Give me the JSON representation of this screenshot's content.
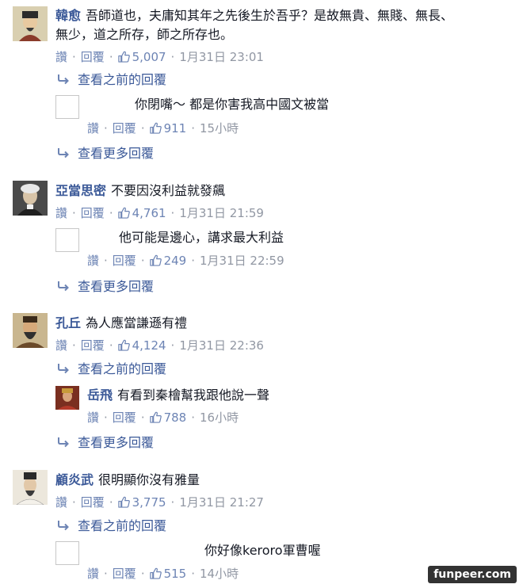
{
  "comments": [
    {
      "name": "韓愈",
      "text_line1": "吾師道也，夫庸知其年之先後生於吾乎？是故無貴、無賤、無長、",
      "text_line2": "無少，道之所存，師之所存也。",
      "like_label": "讚",
      "reply_label": "回覆",
      "likes": "5,007",
      "time": "1月31日 23:01",
      "prev_replies": "查看之前的回覆",
      "reply": {
        "name": "",
        "text": "你閉嘴～ 都是你害我高中國文被當",
        "like_label": "讚",
        "reply_label": "回覆",
        "likes": "911",
        "time": "15小時"
      },
      "more_replies": "查看更多回覆"
    },
    {
      "name": "亞當思密",
      "text_line1": "不要因沒利益就發飆",
      "like_label": "讚",
      "reply_label": "回覆",
      "likes": "4,761",
      "time": "1月31日 21:59",
      "reply": {
        "name": "",
        "text": "他可能是邊心，講求最大利益",
        "like_label": "讚",
        "reply_label": "回覆",
        "likes": "249",
        "time": "1月31日 22:59"
      },
      "more_replies": "查看更多回覆"
    },
    {
      "name": "孔丘",
      "text_line1": "為人應當謙遜有禮",
      "like_label": "讚",
      "reply_label": "回覆",
      "likes": "4,124",
      "time": "1月31日 22:36",
      "prev_replies": "查看之前的回覆",
      "reply": {
        "name": "岳飛",
        "text": "有看到秦檜幫我跟他說一聲",
        "like_label": "讚",
        "reply_label": "回覆",
        "likes": "788",
        "time": "16小時"
      },
      "more_replies": "查看更多回覆"
    },
    {
      "name": "顧炎武",
      "text_line1": "很明顯你沒有雅量",
      "like_label": "讚",
      "reply_label": "回覆",
      "likes": "3,775",
      "time": "1月31日 21:27",
      "prev_replies": "查看之前的回覆",
      "reply": {
        "name": "",
        "text": "你好像keroro軍曹喔",
        "like_label": "讚",
        "reply_label": "回覆",
        "likes": "515",
        "time": "14小時"
      }
    }
  ],
  "watermark": "funpeer.com",
  "colors": {
    "name": "#3b5998",
    "link": "#6d84b4",
    "meta": "#9197a3",
    "text": "#141823"
  }
}
